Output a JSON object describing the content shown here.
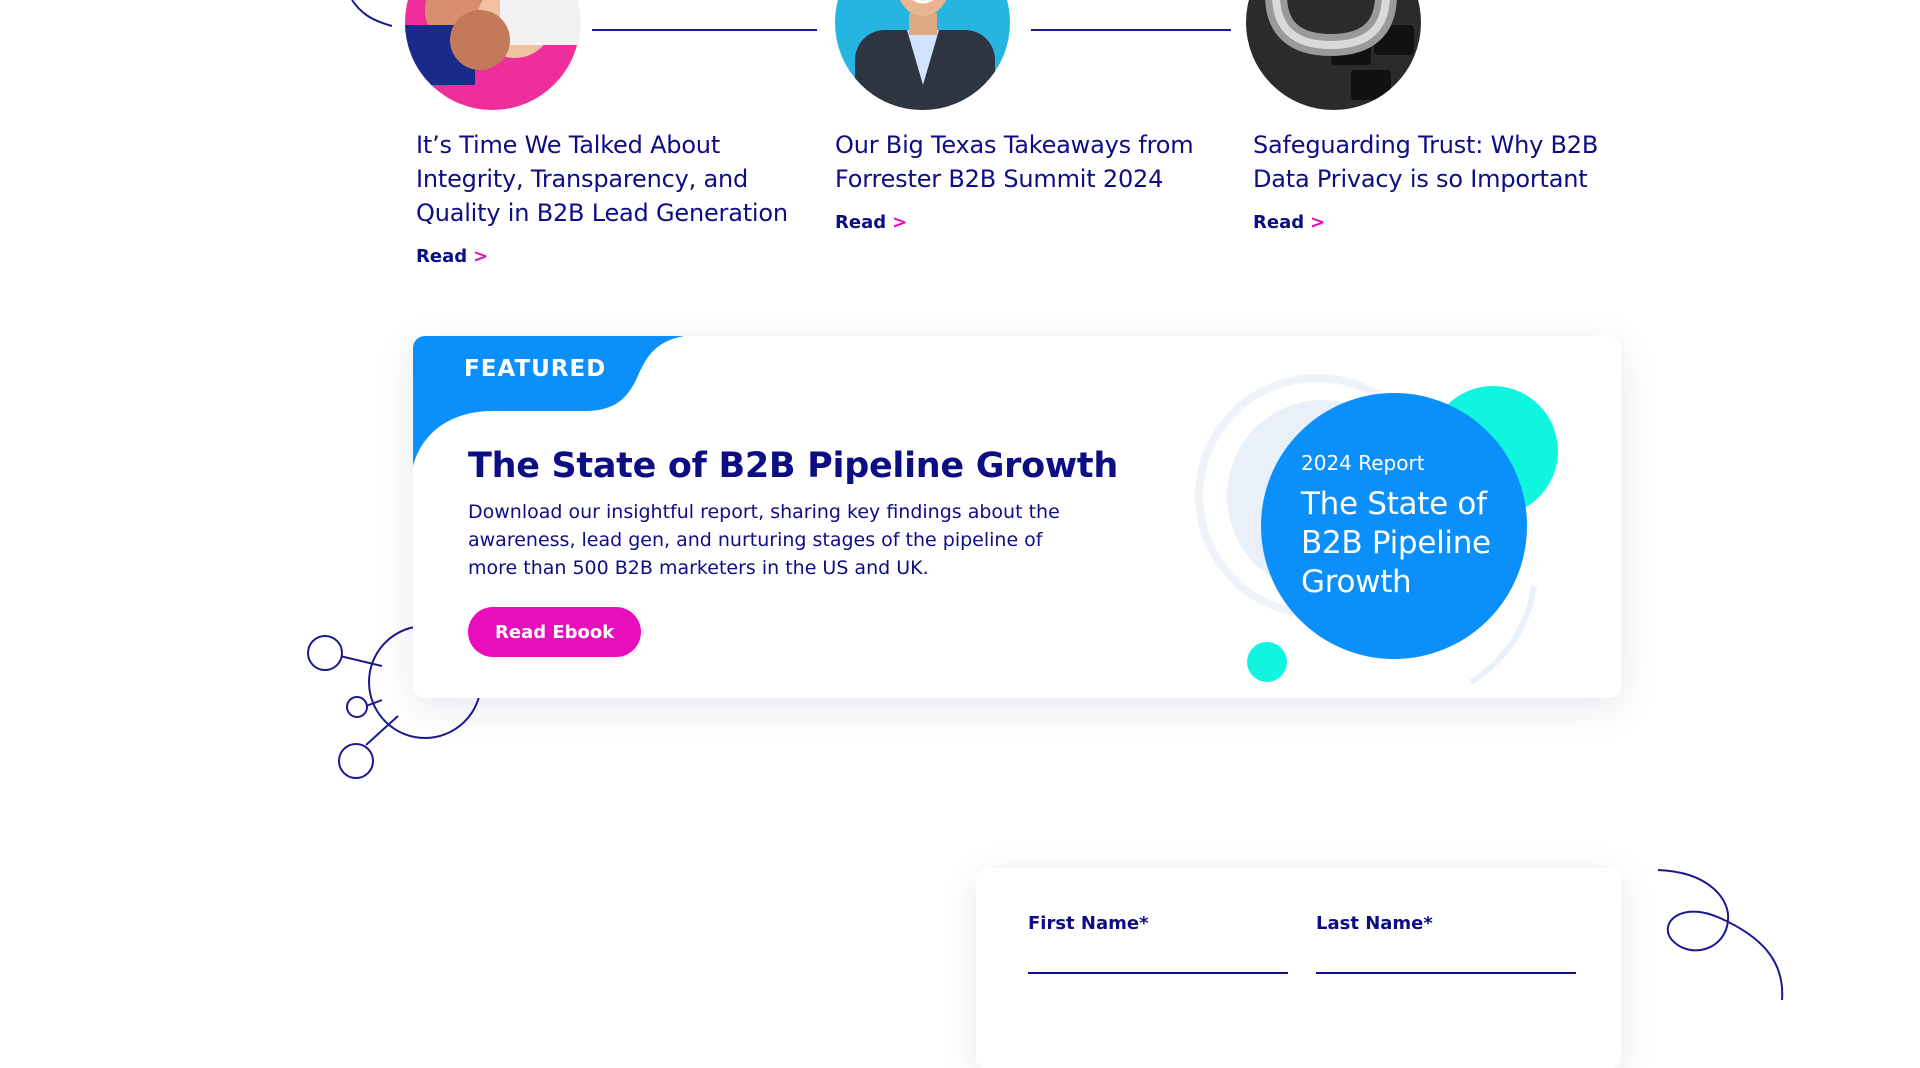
{
  "articles": [
    {
      "title": "It’s Time We Talked About Integrity, Transparency, and Quality in B2B Lead Generation",
      "read_label": "Read",
      "chevron": ">"
    },
    {
      "title": "Our Big Texas Takeaways from Forrester B2B Summit 2024",
      "read_label": "Read",
      "chevron": ">"
    },
    {
      "title": "Safeguarding Trust: Why B2B Data Privacy is so Important",
      "read_label": "Read",
      "chevron": ">"
    }
  ],
  "featured": {
    "label": "FEATURED",
    "title": "The State of B2B Pipeline Growth",
    "description": "Download our insightful report, sharing key findings about the awareness, lead gen, and nurturing stages of the pipeline of more than 500 B2B marketers in the US and UK.",
    "cta_label": "Read Ebook",
    "report": {
      "kicker": "2024 Report",
      "title": "The State of B2B Pipeline Growth"
    }
  },
  "form": {
    "first_name_label": "First Name*",
    "first_name_value": "",
    "last_name_label": "Last Name*",
    "last_name_value": ""
  },
  "colors": {
    "navy": "#0d0d84",
    "magenta": "#ea0dbe",
    "blue": "#0a8ffb",
    "cyan": "#0ff5e0"
  }
}
